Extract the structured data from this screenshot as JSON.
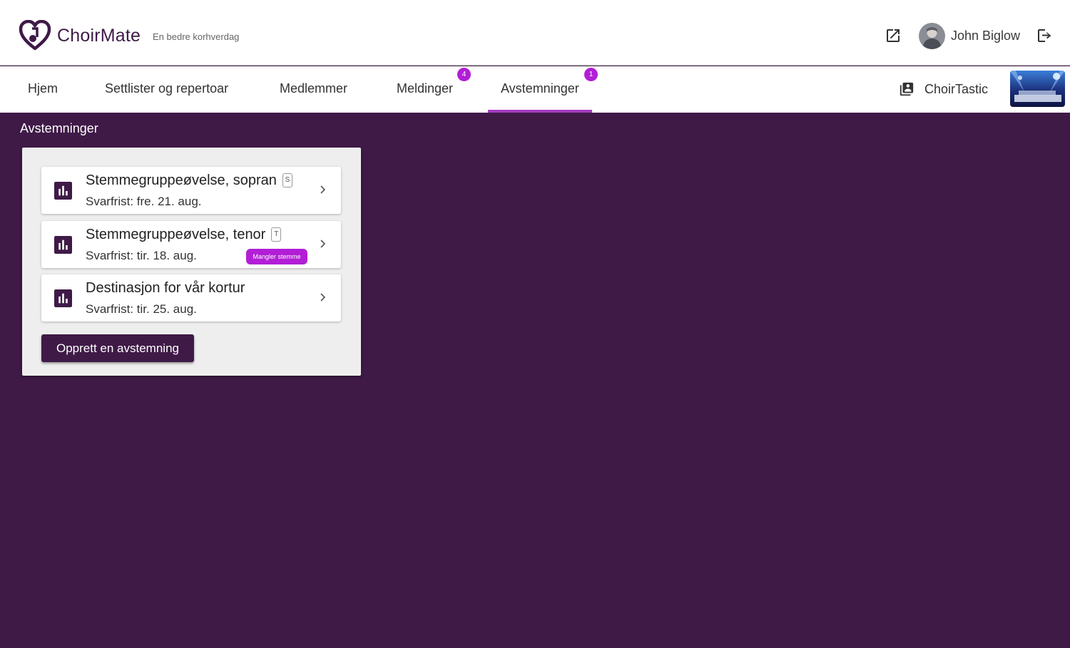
{
  "header": {
    "brand": "ChoirMate",
    "tagline": "En bedre korhverdag",
    "user_name": "John Biglow",
    "icons": {
      "external": "open-in-new-icon",
      "logout": "logout-icon"
    }
  },
  "nav": {
    "tabs": [
      {
        "label": "Hjem"
      },
      {
        "label": "Settlister og repertoar"
      },
      {
        "label": "Medlemmer"
      },
      {
        "label": "Meldinger",
        "badge": "4"
      },
      {
        "label": "Avstemninger",
        "badge": "1",
        "active": true
      }
    ],
    "choir_name": "ChoirTastic"
  },
  "main": {
    "title": "Avstemninger",
    "polls": [
      {
        "title": "Stemmegruppeøvelse, sopran",
        "voice": "S",
        "deadline": "Svarfrist: fre. 21. aug."
      },
      {
        "title": "Stemmegruppeøvelse, tenor",
        "voice": "T",
        "deadline": "Svarfrist: tir. 18. aug.",
        "badge": "Mangler stemme"
      },
      {
        "title": "Destinasjon for vår kortur",
        "deadline": "Svarfrist: tir. 25. aug."
      }
    ],
    "create_label": "Opprett en avstemning"
  },
  "colors": {
    "primary": "#3f1a47",
    "accent": "#a63bbf",
    "badge": "#b21ed6"
  }
}
